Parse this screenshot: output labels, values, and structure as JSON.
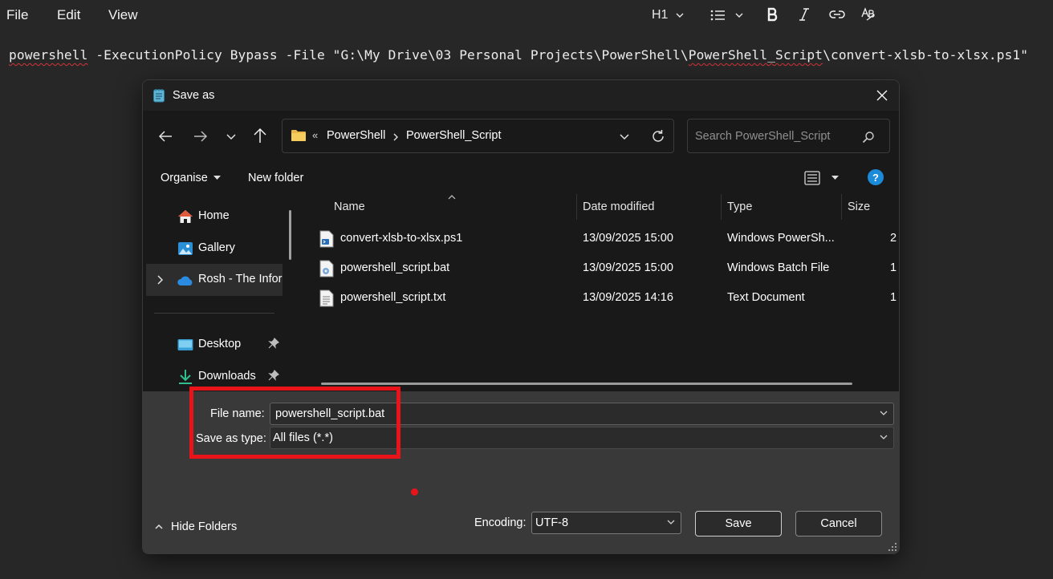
{
  "menubar": {
    "file": "File",
    "edit": "Edit",
    "view": "View",
    "heading": "H1"
  },
  "editor": {
    "word1": "powershell",
    "part2": " -ExecutionPolicy Bypass -File \"G:\\My Drive\\03 Personal Projects\\PowerShell\\",
    "word2": "PowerShell_Script",
    "part3": "\\convert-xlsb-to-xlsx.ps1\""
  },
  "dialog": {
    "title": "Save as",
    "breadcrumb": {
      "overflow": "«",
      "items": [
        "PowerShell",
        "PowerShell_Script"
      ]
    },
    "search_placeholder": "Search PowerShell_Script",
    "organise": "Organise",
    "new_folder": "New folder",
    "help": "?",
    "nav": {
      "items": [
        {
          "label": "Home",
          "icon": "home-icon"
        },
        {
          "label": "Gallery",
          "icon": "gallery-icon"
        },
        {
          "label": "Rosh - The Infor",
          "icon": "onedrive-icon"
        },
        {
          "label": "Desktop",
          "icon": "desktop-icon"
        },
        {
          "label": "Downloads",
          "icon": "downloads-icon"
        }
      ]
    },
    "columns": {
      "name": "Name",
      "date": "Date modified",
      "type": "Type",
      "size": "Size"
    },
    "files": [
      {
        "name": "convert-xlsb-to-xlsx.ps1",
        "date": "13/09/2025 15:00",
        "type": "Windows PowerSh...",
        "size": "2"
      },
      {
        "name": "powershell_script.bat",
        "date": "13/09/2025 15:00",
        "type": "Windows Batch File",
        "size": "1"
      },
      {
        "name": "powershell_script.txt",
        "date": "13/09/2025 14:16",
        "type": "Text Document",
        "size": "1"
      }
    ],
    "file_name_label": "File name:",
    "file_name_value": "powershell_script.bat",
    "save_type_label": "Save as type:",
    "save_type_value": "All files  (*.*)",
    "hide_folders": "Hide Folders",
    "encoding_label": "Encoding:",
    "encoding_value": "UTF-8",
    "save": "Save",
    "cancel": "Cancel"
  },
  "colors": {
    "highlight": "#e8141a",
    "accent": "#0078d4"
  }
}
